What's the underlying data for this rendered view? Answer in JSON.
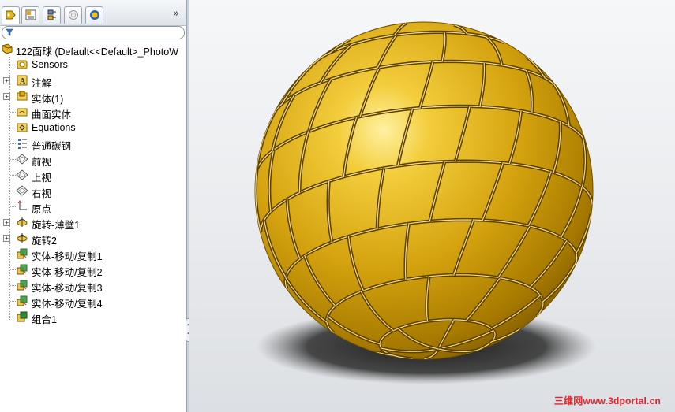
{
  "tabs": [
    {
      "name": "feature-manager",
      "icon": "feature-tree-icon"
    },
    {
      "name": "property-manager",
      "icon": "property-manager-icon"
    },
    {
      "name": "configuration-manager",
      "icon": "configuration-icon"
    },
    {
      "name": "dimxpert-manager",
      "icon": "dimxpert-icon"
    },
    {
      "name": "display-manager",
      "icon": "appearance-icon"
    }
  ],
  "overflow_glyph": "»",
  "filter_icon": "filter-funnel-icon",
  "tree": {
    "root": "122面球  (Default<<Default>_PhotoW",
    "items": [
      {
        "label": "Sensors",
        "icon": "sensor-icon",
        "expandable": false
      },
      {
        "label": "注解",
        "icon": "annotations-icon",
        "expandable": true
      },
      {
        "label": "实体(1)",
        "icon": "solid-bodies-icon",
        "expandable": true
      },
      {
        "label": "曲面实体",
        "icon": "surface-bodies-icon",
        "expandable": false
      },
      {
        "label": "Equations",
        "icon": "equations-icon",
        "expandable": false
      },
      {
        "label": "普通碳钢",
        "icon": "material-icon",
        "expandable": false
      },
      {
        "label": "前视",
        "icon": "plane-icon",
        "expandable": false
      },
      {
        "label": "上视",
        "icon": "plane-icon",
        "expandable": false
      },
      {
        "label": "右视",
        "icon": "plane-icon",
        "expandable": false
      },
      {
        "label": "原点",
        "icon": "origin-icon",
        "expandable": false
      },
      {
        "label": "旋转-薄壁1",
        "icon": "revolve-icon",
        "expandable": true
      },
      {
        "label": "旋转2",
        "icon": "revolve-icon",
        "expandable": true
      },
      {
        "label": "实体-移动/复制1",
        "icon": "move-copy-body-icon",
        "expandable": false
      },
      {
        "label": "实体-移动/复制2",
        "icon": "move-copy-body-icon",
        "expandable": false
      },
      {
        "label": "实体-移动/复制3",
        "icon": "move-copy-body-icon",
        "expandable": false
      },
      {
        "label": "实体-移动/复制4",
        "icon": "move-copy-body-icon",
        "expandable": false
      },
      {
        "label": "组合1",
        "icon": "combine-icon",
        "expandable": false
      }
    ]
  },
  "viewport": {
    "model": "gold-faceted-sphere",
    "model_color": "#d4a20e",
    "background": "#eceef1",
    "watermark": "三维网www.3dportal.cn",
    "watermark_color": "#e4232b"
  }
}
